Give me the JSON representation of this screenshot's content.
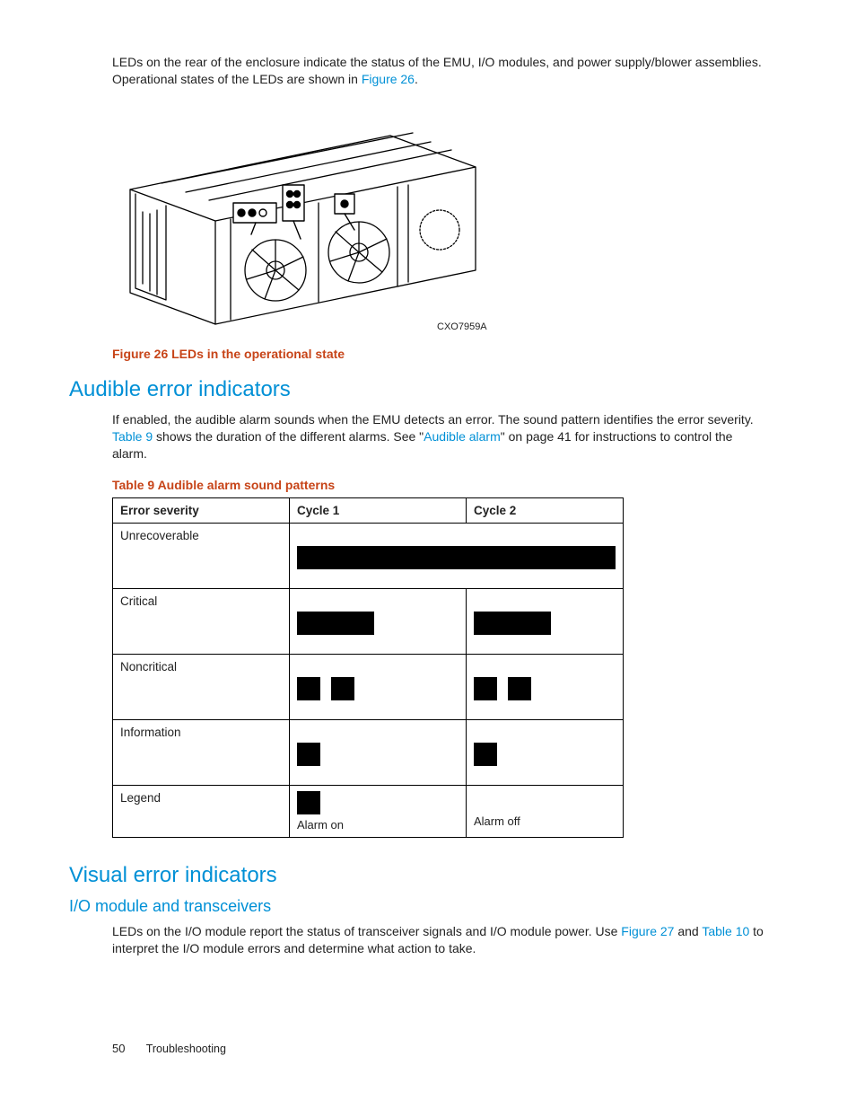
{
  "intro": {
    "p1a": "LEDs on the rear of the enclosure indicate the status of the EMU, I/O modules, and power supply/blower assemblies. Operational states of the LEDs are shown in ",
    "p1link": "Figure 26",
    "p1b": "."
  },
  "figure": {
    "code": "CXO7959A",
    "caption": "Figure 26 LEDs in the operational state"
  },
  "section_audible": {
    "heading": "Audible error indicators",
    "p1a": "If enabled, the audible alarm sounds when the EMU detects an error. The sound pattern identifies the error severity. ",
    "p1link1": "Table 9",
    "p1b": " shows the duration of the different alarms. See \"",
    "p1link2": "Audible alarm",
    "p1c": "\" on page 41 for instructions to control the alarm.",
    "table_title": "Table 9 Audible alarm sound patterns",
    "headers": {
      "c0": "Error severity",
      "c1": "Cycle 1",
      "c2": "Cycle 2"
    },
    "rows": {
      "r0": "Unrecoverable",
      "r1": "Critical",
      "r2": "Noncritical",
      "r3": "Information",
      "r4": "Legend"
    },
    "legend_on": "Alarm on",
    "legend_off": "Alarm off"
  },
  "section_visual": {
    "heading": "Visual error indicators",
    "sub": "I/O module and transceivers",
    "p1a": "LEDs on the I/O module report the status of transceiver signals and I/O module power. Use ",
    "p1link1": "Figure 27",
    "p1b": " and ",
    "p1link2": "Table 10",
    "p1c": " to interpret the I/O module errors and determine what action to take."
  },
  "footer": {
    "page": "50",
    "section": "Troubleshooting"
  },
  "chart_data": {
    "type": "table",
    "title": "Table 9 Audible alarm sound patterns",
    "columns": [
      "Error severity",
      "Cycle 1",
      "Cycle 2"
    ],
    "rows": [
      {
        "severity": "Unrecoverable",
        "cycle1": "continuous on",
        "cycle2": "continuous on"
      },
      {
        "severity": "Critical",
        "cycle1": "long on, off",
        "cycle2": "long on, off"
      },
      {
        "severity": "Noncritical",
        "cycle1": "short on, short on, off",
        "cycle2": "short on, short on, off"
      },
      {
        "severity": "Information",
        "cycle1": "short on, off",
        "cycle2": "short on, off"
      }
    ],
    "legend": {
      "on": "Alarm on (black)",
      "off": "Alarm off (blank)"
    }
  }
}
